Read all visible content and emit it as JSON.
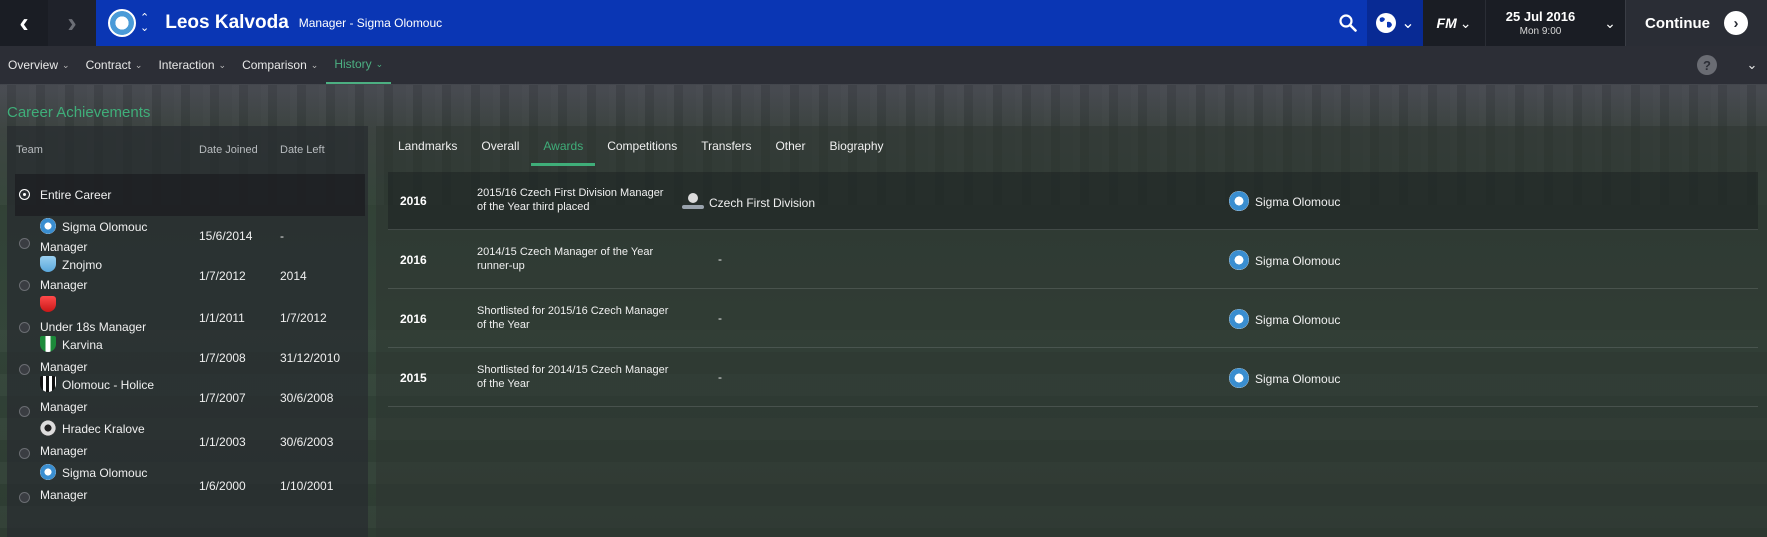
{
  "topbar": {
    "back_label": "‹",
    "forward_label": "›",
    "manager_name": "Leos Kalvoda",
    "manager_role": "Manager - Sigma Olomouc",
    "date": "25 Jul 2016",
    "day_time": "Mon 9:00",
    "continue_label": "Continue",
    "fm_label": "FM"
  },
  "menu": {
    "items": [
      {
        "label": "Overview"
      },
      {
        "label": "Contract"
      },
      {
        "label": "Interaction"
      },
      {
        "label": "Comparison"
      },
      {
        "label": "History"
      }
    ],
    "active": "History",
    "help_label": "?"
  },
  "page_title": "Career Achievements",
  "left_panel": {
    "headers": {
      "team": "Team",
      "date_joined": "Date Joined",
      "date_left": "Date Left"
    },
    "entire_career_label": "Entire Career",
    "rows": [
      {
        "team": "Sigma Olomouc",
        "role": "Manager",
        "joined": "15/6/2014",
        "left": "-",
        "crest": "sigma"
      },
      {
        "team": "Znojmo",
        "role": "Manager",
        "joined": "1/7/2012",
        "left": "2014",
        "crest": "znojmo"
      },
      {
        "team": "",
        "role": "Under 18s Manager",
        "joined": "1/1/2011",
        "left": "1/7/2012",
        "crest": "red"
      },
      {
        "team": "Karvina",
        "role": "Manager",
        "joined": "1/7/2008",
        "left": "31/12/2010",
        "crest": "karvina"
      },
      {
        "team": "Olomouc - Holice",
        "role": "Manager",
        "joined": "1/7/2007",
        "left": "30/6/2008",
        "crest": "holice"
      },
      {
        "team": "Hradec Kralove",
        "role": "Manager",
        "joined": "1/1/2003",
        "left": "30/6/2003",
        "crest": "hradec"
      },
      {
        "team": "Sigma Olomouc",
        "role": "Manager",
        "joined": "1/6/2000",
        "left": "1/10/2001",
        "crest": "sigma"
      }
    ]
  },
  "right_panel": {
    "tabs": [
      {
        "label": "Landmarks"
      },
      {
        "label": "Overall"
      },
      {
        "label": "Awards"
      },
      {
        "label": "Competitions"
      },
      {
        "label": "Transfers"
      },
      {
        "label": "Other"
      },
      {
        "label": "Biography"
      }
    ],
    "active_tab": "Awards",
    "awards": [
      {
        "year": "2016",
        "line1": "2015/16 Czech First Division Manager",
        "line2": "of the Year third placed",
        "competition": "Czech First Division",
        "club": "Sigma Olomouc"
      },
      {
        "year": "2016",
        "line1": "2014/15 Czech Manager of the Year",
        "line2": "runner-up",
        "competition": "-",
        "club": "Sigma Olomouc"
      },
      {
        "year": "2016",
        "line1": "Shortlisted for 2015/16 Czech Manager",
        "line2": "of the Year",
        "competition": "-",
        "club": "Sigma Olomouc"
      },
      {
        "year": "2015",
        "line1": "Shortlisted for 2014/15 Czech Manager",
        "line2": "of the Year",
        "competition": "-",
        "club": "Sigma Olomouc"
      }
    ]
  },
  "colors": {
    "topbar_blue": "#0a36b4",
    "accent_green": "#3fae79",
    "menu_bg": "#2c2e36"
  }
}
